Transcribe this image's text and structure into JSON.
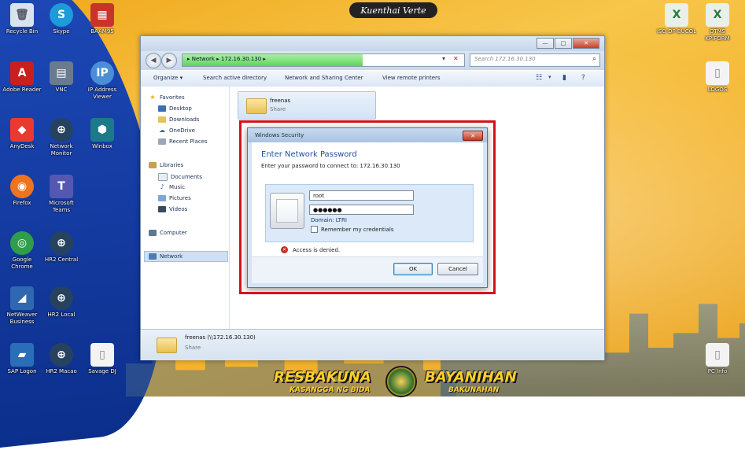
{
  "desktop": {
    "logo": "Kuenthai Verte",
    "left_icons": [
      {
        "label": "Recycle Bin",
        "icon": "recycle-bin-icon",
        "color": "#d9e3ee"
      },
      {
        "label": "Skype",
        "icon": "skype-icon",
        "color": "#1e9bd8"
      },
      {
        "label": "BAAM95",
        "icon": "app-cubes-icon",
        "color": "#c9342a"
      },
      {
        "label": "Adobe Reader",
        "icon": "pdf-icon",
        "color": "#c8201c"
      },
      {
        "label": "VNC",
        "icon": "vnc-icon",
        "color": "#6a7b8f"
      },
      {
        "label": "IP Address Viewer",
        "icon": "ip-icon",
        "color": "#4a8ed6"
      },
      {
        "label": "AnyDesk",
        "icon": "anydesk-icon",
        "color": "#ea3a30"
      },
      {
        "label": "Network Monitor",
        "icon": "globe-icon",
        "color": "#27425e"
      },
      {
        "label": "Winbox",
        "icon": "winbox-icon",
        "color": "#1d7a8a"
      },
      {
        "label": "Firefox",
        "icon": "firefox-icon",
        "color": "#f0741e"
      },
      {
        "label": "Microsoft Teams",
        "icon": "teams-icon",
        "color": "#5458b2"
      },
      {
        "label": "Google Chrome",
        "icon": "chrome-icon",
        "color": "#2f9e4a"
      },
      {
        "label": "HR2 Central",
        "icon": "globe-icon",
        "color": "#27425e"
      },
      {
        "label": "NetWeaver Business",
        "icon": "sap-icon",
        "color": "#2f67b1"
      },
      {
        "label": "HR2 Local",
        "icon": "globe-icon",
        "color": "#27425e"
      },
      {
        "label": "SAP Logon",
        "icon": "sap-logon-icon",
        "color": "#2a6eb8"
      },
      {
        "label": "HR2 Macao",
        "icon": "globe-icon",
        "color": "#27425e"
      },
      {
        "label": "Savage DJ",
        "icon": "document-icon",
        "color": "#f3f3f3"
      }
    ],
    "right_icons": [
      {
        "label": "ISO DP-BUCOL",
        "icon": "excel-icon",
        "color": "#e9efe9"
      },
      {
        "label": "OTMS KPIFORM",
        "icon": "excel-icon",
        "color": "#e9efe9"
      },
      {
        "label": "LOGOS",
        "icon": "document-icon",
        "color": "#f3f3f3"
      },
      {
        "label": "PC Info",
        "icon": "document-icon",
        "color": "#f3f3f3"
      }
    ],
    "banner": {
      "left": "RESBAKUNA",
      "left_sub": "KASANGGA NG BIDA",
      "right": "BAYANIHAN",
      "right_sub": "BAKUNAHAN"
    }
  },
  "explorer": {
    "window_buttons": {
      "minimize": "—",
      "maximize": "□",
      "close": "✕"
    },
    "address": {
      "parts": [
        "Network",
        "172.16.30.130"
      ],
      "text": "▸ Network ▸ 172.16.30.130 ▸",
      "progress_fraction": 0.64
    },
    "search_placeholder": "Search 172.16.30.130",
    "toolbar": {
      "organize": "Organize ▾",
      "search_ad": "Search active directory",
      "network_center": "Network and Sharing Center",
      "remote_printers": "View remote printers"
    },
    "sidebar": {
      "favorites": "Favorites",
      "fav_items": [
        "Desktop",
        "Downloads",
        "OneDrive",
        "Recent Places"
      ],
      "libraries": "Libraries",
      "lib_items": [
        "Documents",
        "Music",
        "Pictures",
        "Videos"
      ],
      "computer": "Computer",
      "network": "Network"
    },
    "share": {
      "name": "freenas",
      "type": "Share"
    },
    "details": {
      "name": "freenas (\\\\172.16.30.130)",
      "type": "Share"
    }
  },
  "dialog": {
    "title": "Windows Security",
    "close": "✕",
    "heading": "Enter Network Password",
    "description": "Enter your password to connect to: 172.16.30.130",
    "username": "root",
    "password": "●●●●●●",
    "domain": "Domain: LTRI",
    "remember": "Remember my credentials",
    "error": "Access is denied.",
    "ok": "OK",
    "cancel": "Cancel"
  },
  "colors": {
    "highlight": "#d6101e",
    "accent": "#1f4f96",
    "desktop_gold": "#f0a81c"
  }
}
